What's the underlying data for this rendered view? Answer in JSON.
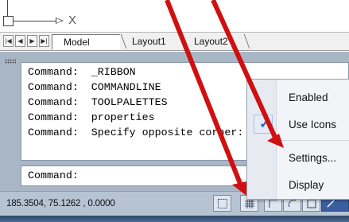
{
  "drawing": {
    "ucs_x_label": "X"
  },
  "tabs": {
    "nav_first": "|◀",
    "nav_prev": "◀",
    "nav_next": "▶",
    "nav_last": "▶|",
    "items": [
      {
        "label": "Model"
      },
      {
        "label": "Layout1"
      },
      {
        "label": "Layout2"
      }
    ]
  },
  "command_window": {
    "history": [
      "Command:  _RIBBON",
      "Command:  COMMANDLINE",
      "Command:  TOOLPALETTES",
      "Command:  properties",
      "Command:  Specify opposite corner:"
    ],
    "prompt": "Command:"
  },
  "status_bar": {
    "coordinates": "185.3504, 75.1262 , 0.0000"
  },
  "context_menu": {
    "items": [
      {
        "label": "Enabled",
        "checked": false
      },
      {
        "label": "Use Icons",
        "checked": true
      },
      {
        "label": "Settings...",
        "checked": false
      },
      {
        "label": "Display",
        "checked": false
      }
    ]
  },
  "colors": {
    "annotation_arrow": "#d01010",
    "checkmark": "#2b62c4",
    "statusbar": "#b6c3d3"
  }
}
